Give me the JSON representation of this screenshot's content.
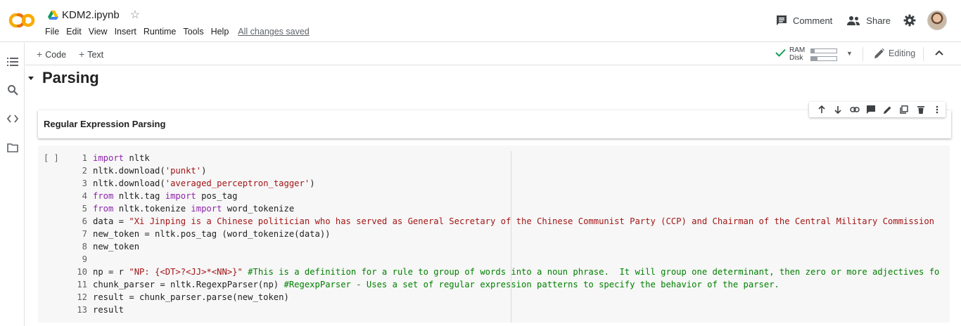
{
  "app": {
    "logo_text": "CO",
    "doc_title": "KDM2.ipynb",
    "menu": [
      "File",
      "Edit",
      "View",
      "Insert",
      "Runtime",
      "Tools",
      "Help"
    ],
    "save_status": "All changes saved",
    "comment_label": "Comment",
    "share_label": "Share",
    "accent_color": "#f9ab00"
  },
  "toolbar": {
    "add_code": "Code",
    "add_text": "Text",
    "ram_label": "RAM",
    "disk_label": "Disk",
    "ram_usage": 0.15,
    "disk_usage": 0.25,
    "editing_label": "Editing"
  },
  "notebook": {
    "section_heading": "Parsing",
    "text_cell_heading": "Regular Expression Parsing",
    "code_cell": {
      "run_indicator": "[ ]",
      "lines": [
        {
          "n": "1",
          "segs": [
            [
              "kw",
              "import"
            ],
            [
              "src",
              " nltk"
            ]
          ]
        },
        {
          "n": "2",
          "segs": [
            [
              "src",
              "nltk.download("
            ],
            [
              "str",
              "'punkt'"
            ],
            [
              "src",
              ")"
            ]
          ]
        },
        {
          "n": "3",
          "segs": [
            [
              "src",
              "nltk.download("
            ],
            [
              "str",
              "'averaged_perceptron_tagger'"
            ],
            [
              "src",
              ")"
            ]
          ]
        },
        {
          "n": "4",
          "segs": [
            [
              "kw",
              "from"
            ],
            [
              "src",
              " nltk.tag "
            ],
            [
              "kw",
              "import"
            ],
            [
              "src",
              " pos_tag"
            ]
          ]
        },
        {
          "n": "5",
          "segs": [
            [
              "kw",
              "from"
            ],
            [
              "src",
              " nltk.tokenize "
            ],
            [
              "kw",
              "import"
            ],
            [
              "src",
              " word_tokenize"
            ]
          ]
        },
        {
          "n": "6",
          "segs": [
            [
              "src",
              "data = "
            ],
            [
              "str",
              "\"Xi Jinping is a Chinese politician who has served as General Secretary of the Chinese Communist Party (CCP) and Chairman of the Central Military Commission"
            ]
          ]
        },
        {
          "n": "7",
          "segs": [
            [
              "src",
              "new_token = nltk.pos_tag (word_tokenize(data))"
            ]
          ]
        },
        {
          "n": "8",
          "segs": [
            [
              "src",
              "new_token"
            ]
          ]
        },
        {
          "n": "9",
          "segs": []
        },
        {
          "n": "10",
          "segs": [
            [
              "src",
              "np = r "
            ],
            [
              "str",
              "\"NP: {<DT>?<JJ>*<NN>}\""
            ],
            [
              "src",
              " "
            ],
            [
              "cm",
              "#This is a definition for a rule to group of words into a noun phrase.  It will group one determinant, then zero or more adjectives fo"
            ]
          ]
        },
        {
          "n": "11",
          "segs": [
            [
              "src",
              "chunk_parser = nltk.RegexpParser(np) "
            ],
            [
              "cm",
              "#RegexpParser - Uses a set of regular expression patterns to specify the behavior of the parser."
            ]
          ]
        },
        {
          "n": "12",
          "segs": [
            [
              "src",
              "result = chunk_parser.parse(new_token)"
            ]
          ]
        },
        {
          "n": "13",
          "segs": [
            [
              "src",
              "result"
            ]
          ]
        }
      ]
    }
  }
}
